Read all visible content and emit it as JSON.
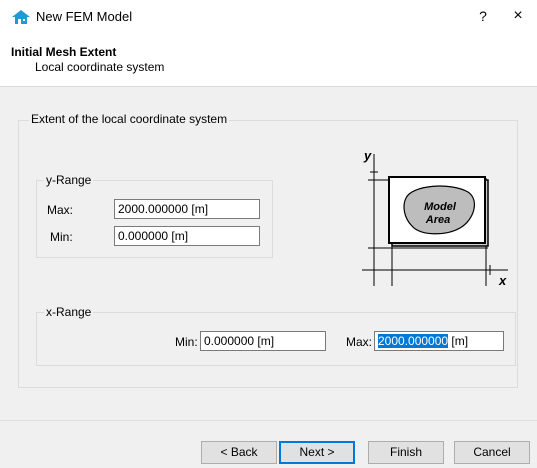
{
  "window": {
    "title": "New FEM Model",
    "help_label": "?",
    "close_label": "×"
  },
  "header": {
    "title": "Initial Mesh Extent",
    "subtitle": "Local coordinate system"
  },
  "extent_group": {
    "label": "Extent of the local coordinate system"
  },
  "y_range": {
    "label": "y-Range",
    "max_label": "Max:",
    "max_value": "2000.000000 [m]",
    "min_label": "Min:",
    "min_value": "0.000000 [m]"
  },
  "x_range": {
    "label": "x-Range",
    "min_label": "Min:",
    "min_value": "0.000000 [m]",
    "max_label": "Max:",
    "max_value_selected": "2000.000000",
    "max_value_unit": " [m]"
  },
  "diagram": {
    "y_axis": "y",
    "x_axis": "x",
    "area_line1": "Model",
    "area_line2": "Area"
  },
  "buttons": {
    "back": "< Back",
    "next": "Next >",
    "finish": "Finish",
    "cancel": "Cancel"
  },
  "colors": {
    "selection": "#0078d7",
    "panel_bg": "#f0f0f0",
    "app_icon": "#1f9ad6"
  }
}
